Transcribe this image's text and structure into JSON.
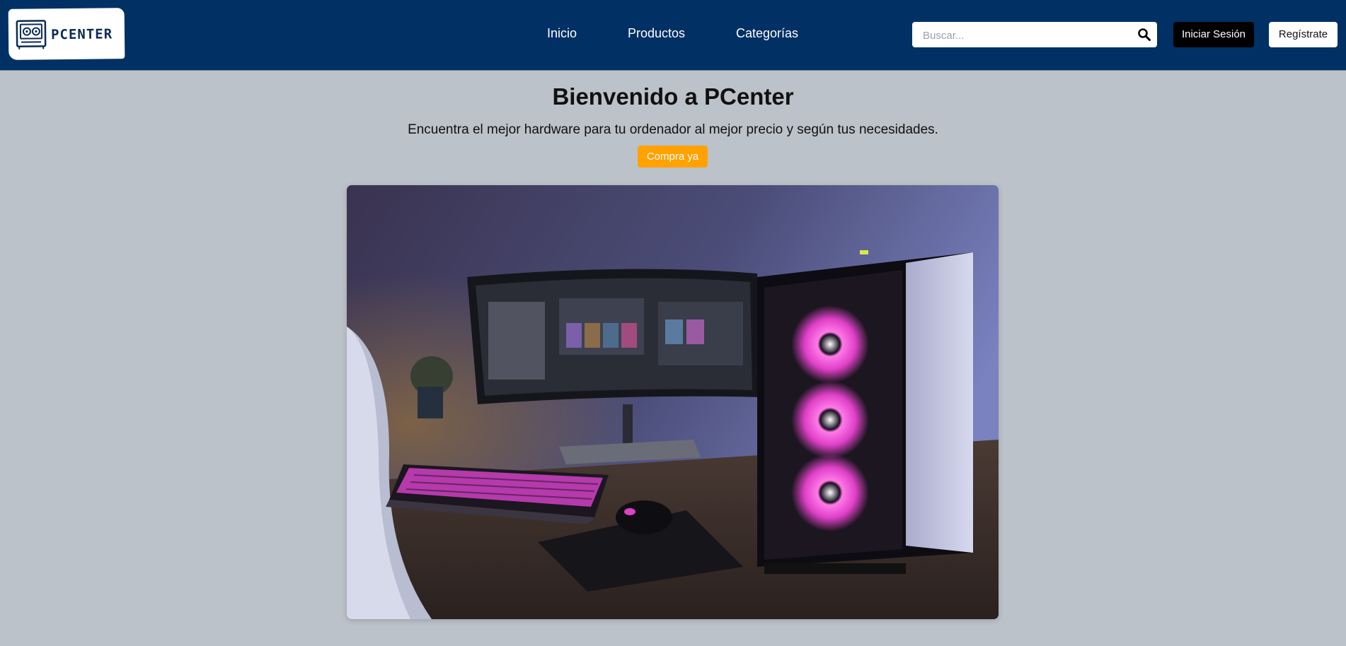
{
  "header": {
    "logo": {
      "text": "PCENTER",
      "icon": "pc-case-icon"
    },
    "nav": [
      {
        "label": "Inicio"
      },
      {
        "label": "Productos"
      },
      {
        "label": "Categorías"
      }
    ],
    "search": {
      "placeholder": "Buscar...",
      "value": "",
      "icon": "search-icon"
    },
    "login_label": "Iniciar Sesión",
    "register_label": "Regístrate"
  },
  "hero": {
    "title": "Bienvenido a PCenter",
    "subtitle": "Encuentra el mejor hardware para tu ordenador al mejor precio y según tus necesidades.",
    "cta_label": "Compra ya",
    "image": {
      "alt": "Gaming PC setup with RGB fans, keyboard and ultrawide monitor"
    }
  },
  "colors": {
    "header_bg": "#003064",
    "page_bg": "#bcc2c9",
    "cta_bg": "#ffa200",
    "login_bg": "#000000",
    "rgb_accent": "#e040c8"
  }
}
